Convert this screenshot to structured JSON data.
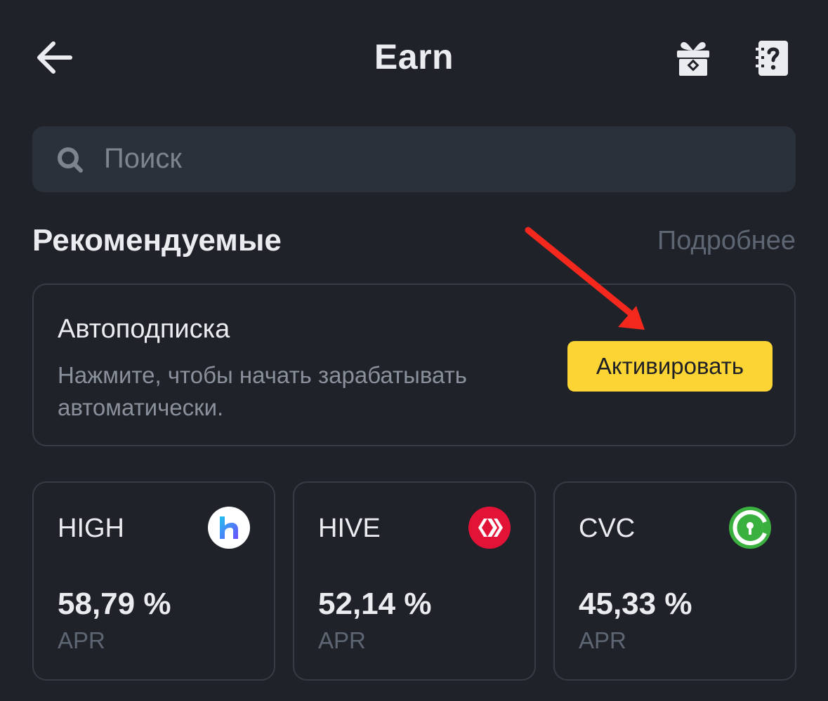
{
  "header": {
    "title": "Earn",
    "back_icon": "arrow-left-icon",
    "gift_icon": "gift-icon",
    "help_icon": "question-document-icon"
  },
  "search": {
    "placeholder": "Поиск",
    "icon": "search-icon"
  },
  "recommended": {
    "title": "Рекомендуемые",
    "more_label": "Подробнее"
  },
  "auto_subscribe": {
    "title": "Автоподписка",
    "description": "Нажмите, чтобы начать зарабатывать автоматически.",
    "button_label": "Активировать"
  },
  "annotation": {
    "arrow_color": "#f5281e"
  },
  "coins": [
    {
      "name": "HIGH",
      "apr": "58,79 %",
      "apr_label": "APR",
      "icon": "highstreet-logo-icon"
    },
    {
      "name": "HIVE",
      "apr": "52,14 %",
      "apr_label": "APR",
      "icon": "hive-logo-icon"
    },
    {
      "name": "CVC",
      "apr": "45,33 %",
      "apr_label": "APR",
      "icon": "civic-logo-icon"
    }
  ],
  "colors": {
    "background": "#1f2329",
    "surface": "#2b313a",
    "accent": "#fcd535",
    "text_primary": "#eaecef",
    "text_secondary": "#8a919c",
    "text_muted": "#5e6673"
  }
}
